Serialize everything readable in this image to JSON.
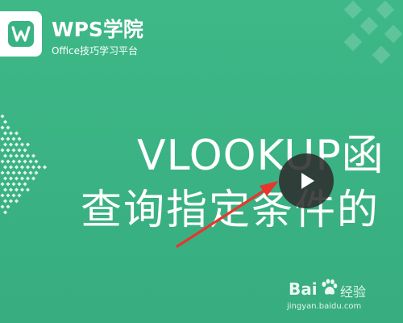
{
  "brand": {
    "title": "WPS学院",
    "subtitle": "Office技巧学习平台",
    "icon": "wps-logo-icon"
  },
  "video": {
    "title_line1": "VLOOKUP函",
    "title_line2": "查询指定条件的",
    "play_icon": "play-icon"
  },
  "watermark": {
    "brand_text": "Bai",
    "brand_suffix": "经验",
    "url": "jingyan.baidu.com",
    "icon": "baidu-paw-icon"
  },
  "annotation": {
    "icon": "red-arrow-icon"
  },
  "colors": {
    "background": "#3ab384",
    "accent": "#ffffff",
    "play_button": "#2d2d2d",
    "arrow": "#e8352e",
    "logo_green": "#3ab384"
  }
}
